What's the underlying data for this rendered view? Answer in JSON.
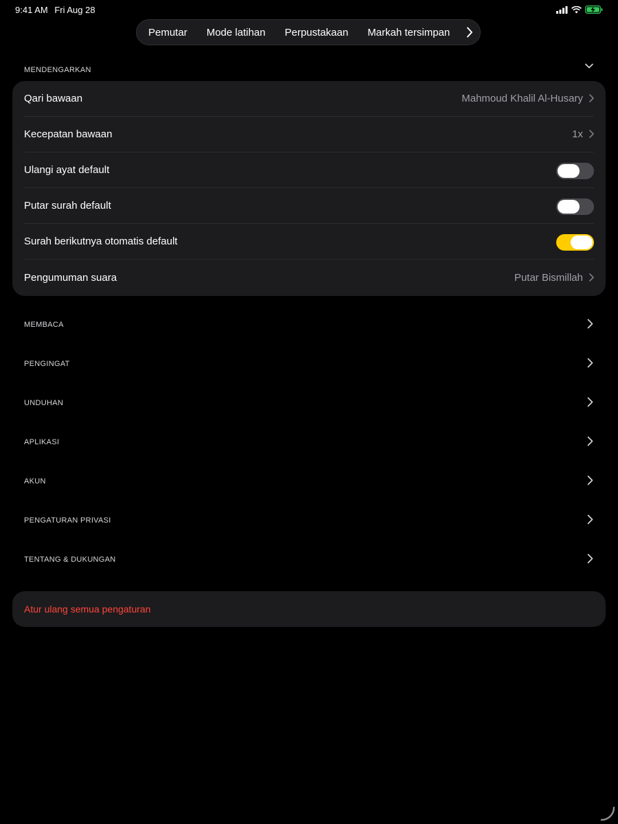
{
  "status": {
    "time": "9:41 AM",
    "date": "Fri Aug 28"
  },
  "nav": {
    "tabs": [
      "Pemutar",
      "Mode latihan",
      "Perpustakaan",
      "Markah tersimpan"
    ]
  },
  "listening": {
    "header": "MENDENGARKAN",
    "rows": [
      {
        "label": "Qari bawaan",
        "value": "Mahmoud Khalil Al-Husary"
      },
      {
        "label": "Kecepatan bawaan",
        "value": "1x"
      },
      {
        "label": "Ulangi ayat default",
        "toggle": false
      },
      {
        "label": "Putar surah default",
        "toggle": false
      },
      {
        "label": "Surah berikutnya otomatis default",
        "toggle": true
      },
      {
        "label": "Pengumuman suara",
        "value": "Putar Bismillah"
      }
    ]
  },
  "groups": [
    "MEMBACA",
    "PENGINGAT",
    "UNDUHAN",
    "APLIKASI",
    "AKUN",
    "PENGATURAN PRIVASI",
    "TENTANG & DUKUNGAN"
  ],
  "reset": {
    "label": "Atur ulang semua pengaturan"
  },
  "colors": {
    "accent": "#ffcc00",
    "destructive": "#ff453a",
    "card": "#1c1c1e",
    "battery": "#34c759"
  }
}
